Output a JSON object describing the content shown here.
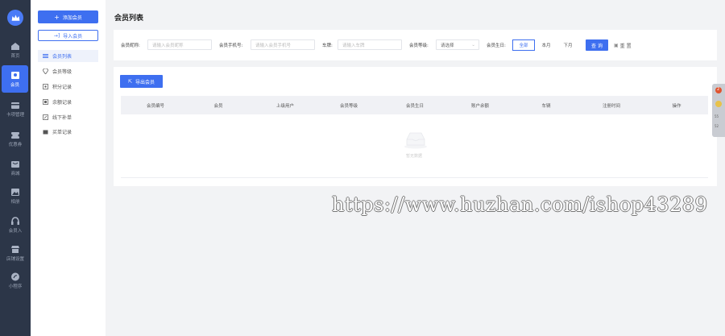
{
  "rail": {
    "items": [
      {
        "label": "首页"
      },
      {
        "label": "会员"
      },
      {
        "label": "卡项管理"
      },
      {
        "label": "优惠券"
      },
      {
        "label": "商城"
      },
      {
        "label": "相册"
      },
      {
        "label": "会员入"
      },
      {
        "label": "店铺设置"
      },
      {
        "label": "小程序"
      }
    ]
  },
  "subnav": {
    "add_label": "添加会员",
    "import_label": "导入会员",
    "items": [
      {
        "label": "会员列表"
      },
      {
        "label": "会员等级"
      },
      {
        "label": "积分记录"
      },
      {
        "label": "余额记录"
      },
      {
        "label": "线下补单"
      },
      {
        "label": "买单记录"
      }
    ]
  },
  "main": {
    "title": "会员列表",
    "filters": {
      "nickname_label": "会员昵称:",
      "nickname_placeholder": "请输入会员昵称",
      "phone_label": "会员手机号:",
      "phone_placeholder": "请输入会员手机号",
      "plate_label": "车牌:",
      "plate_placeholder": "请输入车牌",
      "level_label": "会员等级:",
      "level_value": "请选择",
      "birthday_label": "会员生日:",
      "birthday_options": [
        "全部",
        "本月",
        "下月"
      ],
      "query_label": "查 询",
      "reset_label": "重 置"
    },
    "export_label": "导出会员",
    "columns": [
      "会员编号",
      "会员",
      "上级用户",
      "会员等级",
      "会员生日",
      "账户余额",
      "车辆",
      "注册时间",
      "操作"
    ],
    "empty_text": "暂无数据"
  },
  "watermark": "https://www.huzhan.com/ishop43289",
  "float_bar": {
    "badge": "2",
    "items": [
      "55",
      "52"
    ]
  },
  "colors": {
    "accent": "#3e6ff0",
    "rail_bg": "#2c3648"
  }
}
